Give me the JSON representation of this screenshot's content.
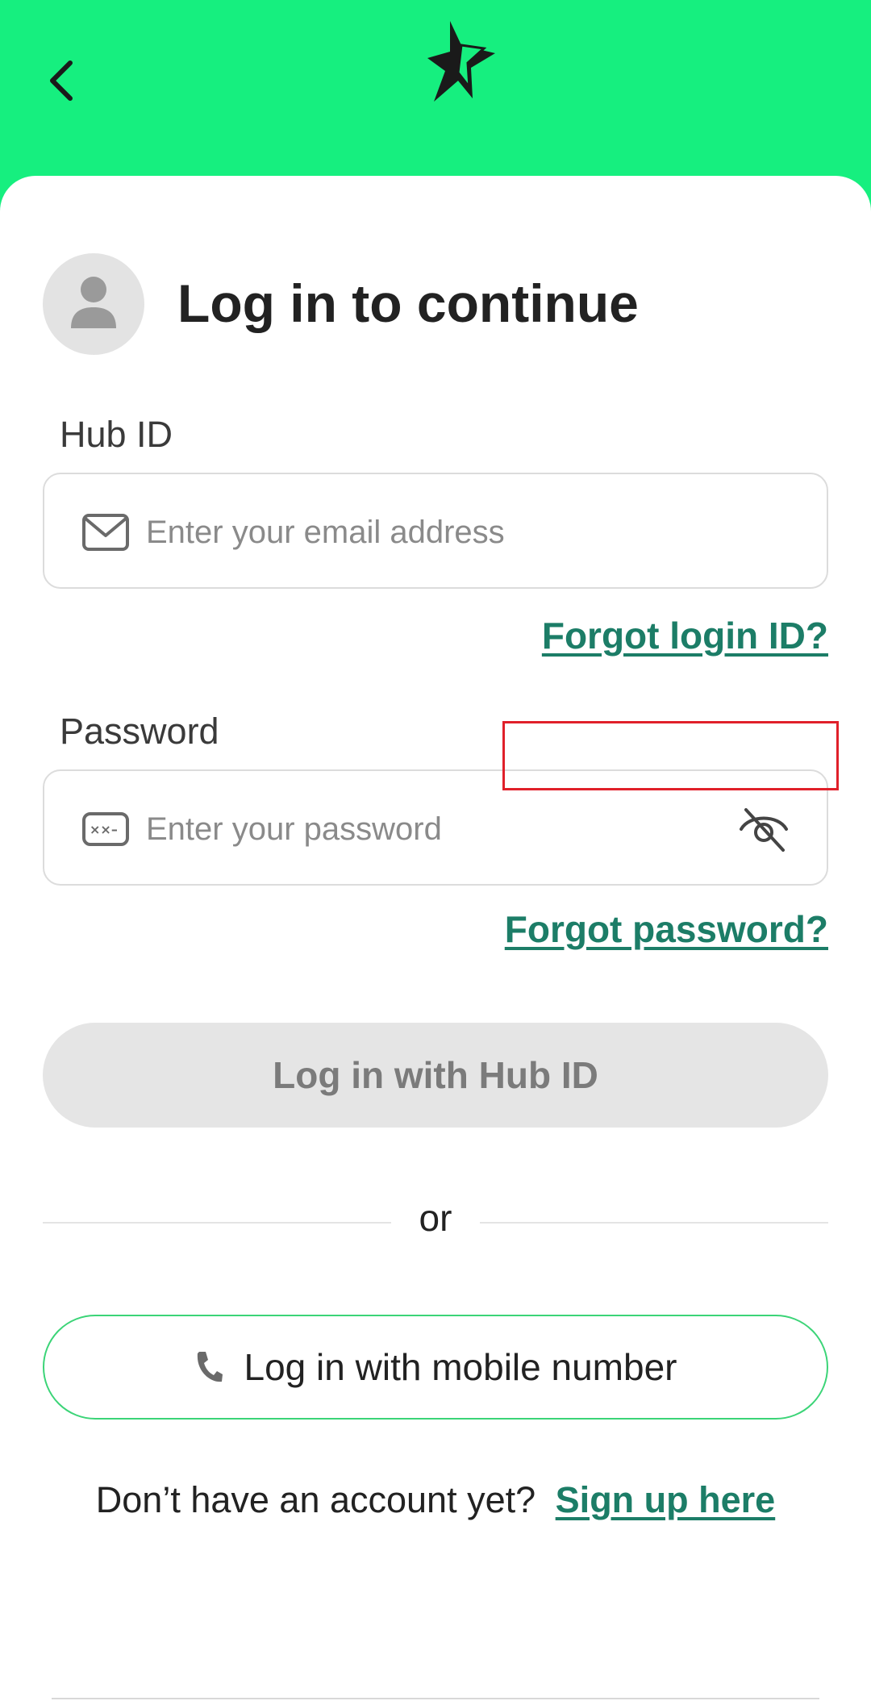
{
  "header": {
    "back_icon": "chevron-left-icon",
    "logo_icon": "star-logo-icon",
    "background_color": "#16ef7f"
  },
  "login": {
    "avatar_icon": "user-avatar-icon",
    "title": "Log in to continue",
    "hub_id": {
      "label": "Hub ID",
      "icon": "envelope-icon",
      "placeholder": "Enter your email address",
      "value": ""
    },
    "forgot_login_id": "Forgot login ID?",
    "password": {
      "label": "Password",
      "icon": "password-field-icon",
      "placeholder": "Enter your password",
      "value": "",
      "toggle_icon": "eye-slash-icon"
    },
    "forgot_password": "Forgot password?",
    "primary_button": "Log in with Hub ID",
    "divider_text": "or",
    "mobile_button": {
      "icon": "phone-icon",
      "label": "Log in with mobile number"
    },
    "signup_prompt": "Don’t have an account yet?",
    "signup_link": "Sign up here"
  },
  "colors": {
    "accent_green": "#16ef7f",
    "link_color": "#1c7d67",
    "highlight_border": "#e0202a"
  }
}
